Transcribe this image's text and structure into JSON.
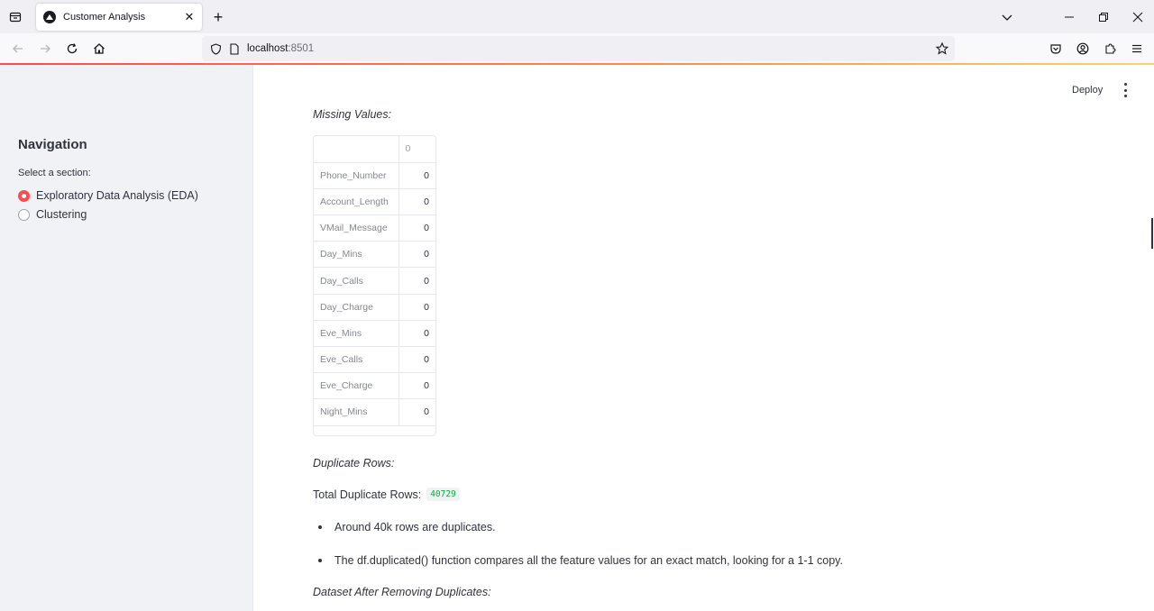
{
  "browser": {
    "tab_title": "Customer Analysis",
    "url_host": "localhost",
    "url_port": ":8501"
  },
  "sidebar": {
    "title": "Navigation",
    "select_label": "Select a section:",
    "options": [
      {
        "label": "Exploratory Data Analysis (EDA)",
        "selected": true
      },
      {
        "label": "Clustering",
        "selected": false
      }
    ]
  },
  "toolbar": {
    "deploy_label": "Deploy"
  },
  "main": {
    "missing_values_heading": "Missing Values:",
    "missing_table": {
      "column_header": "0",
      "rows": [
        {
          "name": "Phone_Number",
          "value": "0"
        },
        {
          "name": "Account_Length",
          "value": "0"
        },
        {
          "name": "VMail_Message",
          "value": "0"
        },
        {
          "name": "Day_Mins",
          "value": "0"
        },
        {
          "name": "Day_Calls",
          "value": "0"
        },
        {
          "name": "Day_Charge",
          "value": "0"
        },
        {
          "name": "Eve_Mins",
          "value": "0"
        },
        {
          "name": "Eve_Calls",
          "value": "0"
        },
        {
          "name": "Eve_Charge",
          "value": "0"
        },
        {
          "name": "Night_Mins",
          "value": "0"
        }
      ]
    },
    "duplicate_heading": "Duplicate Rows:",
    "total_duplicates_label": "Total Duplicate Rows:",
    "total_duplicates_value": "40729",
    "bullets": [
      "Around 40k rows are duplicates.",
      "The df.duplicated() function compares all the feature values for an exact match, looking for a 1-1 copy."
    ],
    "after_heading": "Dataset After Removing Duplicates:"
  }
}
